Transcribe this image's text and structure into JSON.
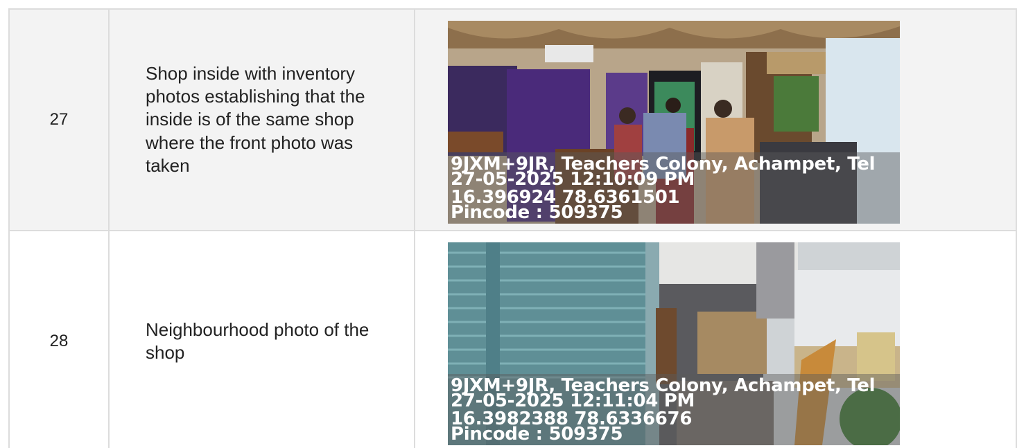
{
  "rows": [
    {
      "number": "27",
      "description": "Shop inside with inventory photos establishing that the inside is of the same shop where the front photo was taken",
      "photo": {
        "address": "9JXM+9JR, Teachers Colony, Achampet, Tel",
        "datetime": "27-05-2025 12:10:09 PM",
        "coordinates": "16.396924 78.6361501",
        "pincode": "Pincode : 509375"
      }
    },
    {
      "number": "28",
      "description": "Neighbourhood photo of the shop",
      "photo": {
        "address": "9JXM+9JR, Teachers Colony, Achampet, Tel",
        "datetime": "27-05-2025 12:11:04 PM",
        "coordinates": "16.3982388 78.6336676",
        "pincode": "Pincode : 509375"
      }
    }
  ]
}
